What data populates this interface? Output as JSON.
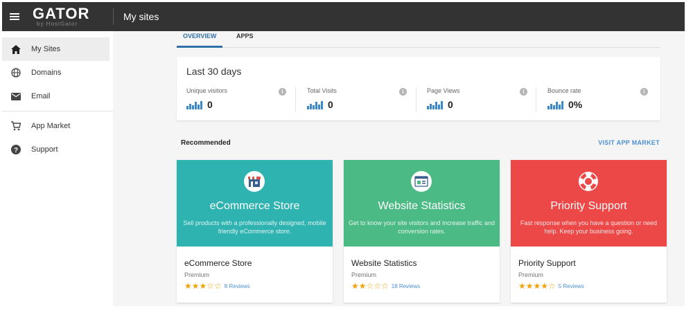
{
  "header": {
    "logo_main": "GATOR",
    "logo_sub": "by HostGator",
    "title": "My sites"
  },
  "sidebar": {
    "items": [
      {
        "label": "My Sites",
        "icon": "home-icon",
        "active": true
      },
      {
        "label": "Domains",
        "icon": "globe-icon",
        "active": false
      },
      {
        "label": "Email",
        "icon": "email-icon",
        "active": false
      },
      {
        "label": "App Market",
        "icon": "cart-icon",
        "active": false
      },
      {
        "label": "Support",
        "icon": "help-icon",
        "active": false
      }
    ]
  },
  "tabs": [
    {
      "label": "OVERVIEW",
      "active": true
    },
    {
      "label": "APPS",
      "active": false
    }
  ],
  "stats": {
    "title": "Last 30 days",
    "items": [
      {
        "label": "Unique visitors",
        "value": "0"
      },
      {
        "label": "Total Visits",
        "value": "0"
      },
      {
        "label": "Page Views",
        "value": "0"
      },
      {
        "label": "Bounce rate",
        "value": "0%"
      }
    ]
  },
  "recommended": {
    "title": "Recommended",
    "link": "VISIT APP MARKET",
    "apps": [
      {
        "banner_title": "eCommerce Store",
        "banner_desc": "Sell products with a professionally designed, mobile friendly eCommerce store.",
        "name": "eCommerce Store",
        "tier": "Premium",
        "stars": "★★★☆☆",
        "reviews": "8 Reviews",
        "color": "#2fb3b0",
        "icon": "storefront-icon"
      },
      {
        "banner_title": "Website Statistics",
        "banner_desc": "Get to know your site visitors and increase traffic and conversion rates.",
        "name": "Website Statistics",
        "tier": "Premium",
        "stars": "★★☆☆☆",
        "reviews": "18 Reviews",
        "color": "#4cba85",
        "icon": "statistics-icon"
      },
      {
        "banner_title": "Priority Support",
        "banner_desc": "Fast response when you have a question or need help. Keep your business going.",
        "name": "Priority Support",
        "tier": "Premium",
        "stars": "★★★★☆",
        "reviews": "5 Reviews",
        "color": "#ec4848",
        "icon": "lifebuoy-icon"
      }
    ]
  },
  "colors": {
    "topbar": "#333333",
    "accent": "#2f6fa8",
    "chart_bars": "#3c89c9",
    "stars": "#f0a30a"
  }
}
